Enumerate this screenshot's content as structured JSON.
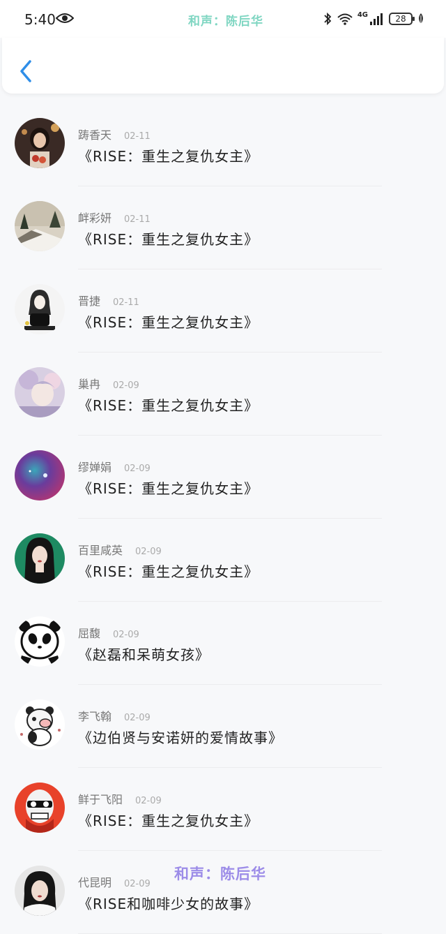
{
  "status_bar": {
    "time": "5:40",
    "watermark": "和声：陈后华",
    "network": "4G",
    "battery": "28"
  },
  "nav": {
    "back_icon": "chevron-left-icon"
  },
  "items": [
    {
      "name": "踌香天",
      "date": "02-11",
      "title": "《RISE：重生之复仇女主》"
    },
    {
      "name": "衅彩妍",
      "date": "02-11",
      "title": "《RISE：重生之复仇女主》"
    },
    {
      "name": "晋捷",
      "date": "02-11",
      "title": "《RISE：重生之复仇女主》"
    },
    {
      "name": "巢冉",
      "date": "02-09",
      "title": "《RISE：重生之复仇女主》"
    },
    {
      "name": "缪婵娟",
      "date": "02-09",
      "title": "《RISE：重生之复仇女主》"
    },
    {
      "name": "百里咸英",
      "date": "02-09",
      "title": "《RISE：重生之复仇女主》"
    },
    {
      "name": "屈馥",
      "date": "02-09",
      "title": "《赵磊和呆萌女孩》"
    },
    {
      "name": "李飞翰",
      "date": "02-09",
      "title": "《边伯贤与安诺妍的爱情故事》"
    },
    {
      "name": "鲜于飞阳",
      "date": "02-09",
      "title": "《RISE：重生之复仇女主》"
    },
    {
      "name": "代昆明",
      "date": "02-09",
      "title": "《RISE和咖啡少女的故事》"
    }
  ],
  "watermark_bottom": "和声：陈后华",
  "colors": {
    "accent": "#2f8ee8",
    "watermark_top": "#7fd6c2",
    "watermark_bottom": "#9c8ce8"
  }
}
